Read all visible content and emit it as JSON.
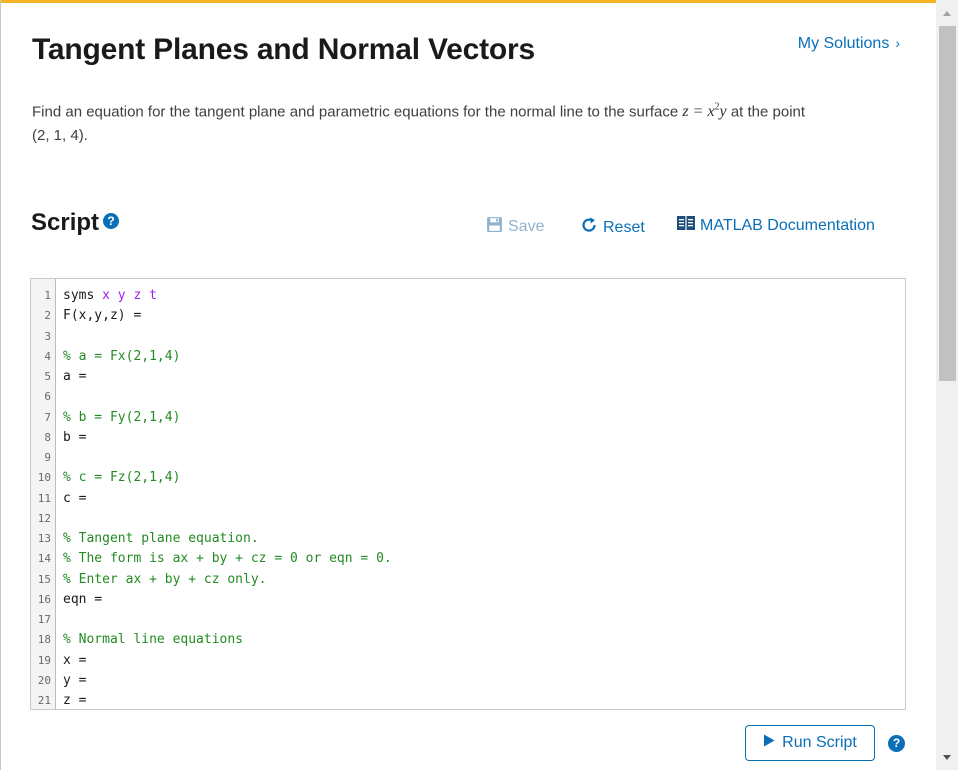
{
  "page": {
    "title": "Tangent Planes and Normal Vectors",
    "my_solutions": "My Solutions",
    "problem_before": "Find an equation for the tangent plane and parametric equations for the normal line to the surface ",
    "problem_math_z": "z = x",
    "problem_math_exp": "2",
    "problem_math_y": "y",
    "problem_after": " at the point",
    "problem_point": "(2, 1, 4)."
  },
  "script": {
    "heading": "Script",
    "save_label": "Save",
    "reset_label": "Reset",
    "docs_label": "MATLAB Documentation"
  },
  "editor": {
    "lines": [
      {
        "n": "1",
        "text": "syms ",
        "vars": "x y z t",
        "type": "syms"
      },
      {
        "n": "2",
        "text": "F(x,y,z) =",
        "type": "code"
      },
      {
        "n": "3",
        "text": "",
        "type": "code"
      },
      {
        "n": "4",
        "text": "% a = Fx(2,1,4)",
        "type": "comment"
      },
      {
        "n": "5",
        "text": "a =",
        "type": "code"
      },
      {
        "n": "6",
        "text": "",
        "type": "code"
      },
      {
        "n": "7",
        "text": "% b = Fy(2,1,4)",
        "type": "comment"
      },
      {
        "n": "8",
        "text": "b =",
        "type": "code"
      },
      {
        "n": "9",
        "text": "",
        "type": "code"
      },
      {
        "n": "10",
        "text": "% c = Fz(2,1,4)",
        "type": "comment"
      },
      {
        "n": "11",
        "text": "c =",
        "type": "code"
      },
      {
        "n": "12",
        "text": "",
        "type": "code"
      },
      {
        "n": "13",
        "text": "% Tangent plane equation.",
        "type": "comment"
      },
      {
        "n": "14",
        "text": "% The form is ax + by + cz = 0 or eqn = 0.",
        "type": "comment"
      },
      {
        "n": "15",
        "text": "% Enter ax + by + cz only.",
        "type": "comment"
      },
      {
        "n": "16",
        "text": "eqn =",
        "type": "code"
      },
      {
        "n": "17",
        "text": "",
        "type": "code"
      },
      {
        "n": "18",
        "text": "% Normal line equations",
        "type": "comment"
      },
      {
        "n": "19",
        "text": "x =",
        "type": "code"
      },
      {
        "n": "20",
        "text": "y =",
        "type": "code"
      },
      {
        "n": "21",
        "text": "z =",
        "type": "code"
      }
    ]
  },
  "actions": {
    "run_label": "Run Script",
    "help_glyph": "?"
  },
  "colors": {
    "accent": "#f5b324",
    "link": "#0a6fb7",
    "comment": "#228b22",
    "keyword_var": "#a020f0"
  },
  "icons": [
    "help-icon",
    "save-icon",
    "reset-icon",
    "book-icon",
    "play-icon",
    "chevron-right-icon"
  ]
}
